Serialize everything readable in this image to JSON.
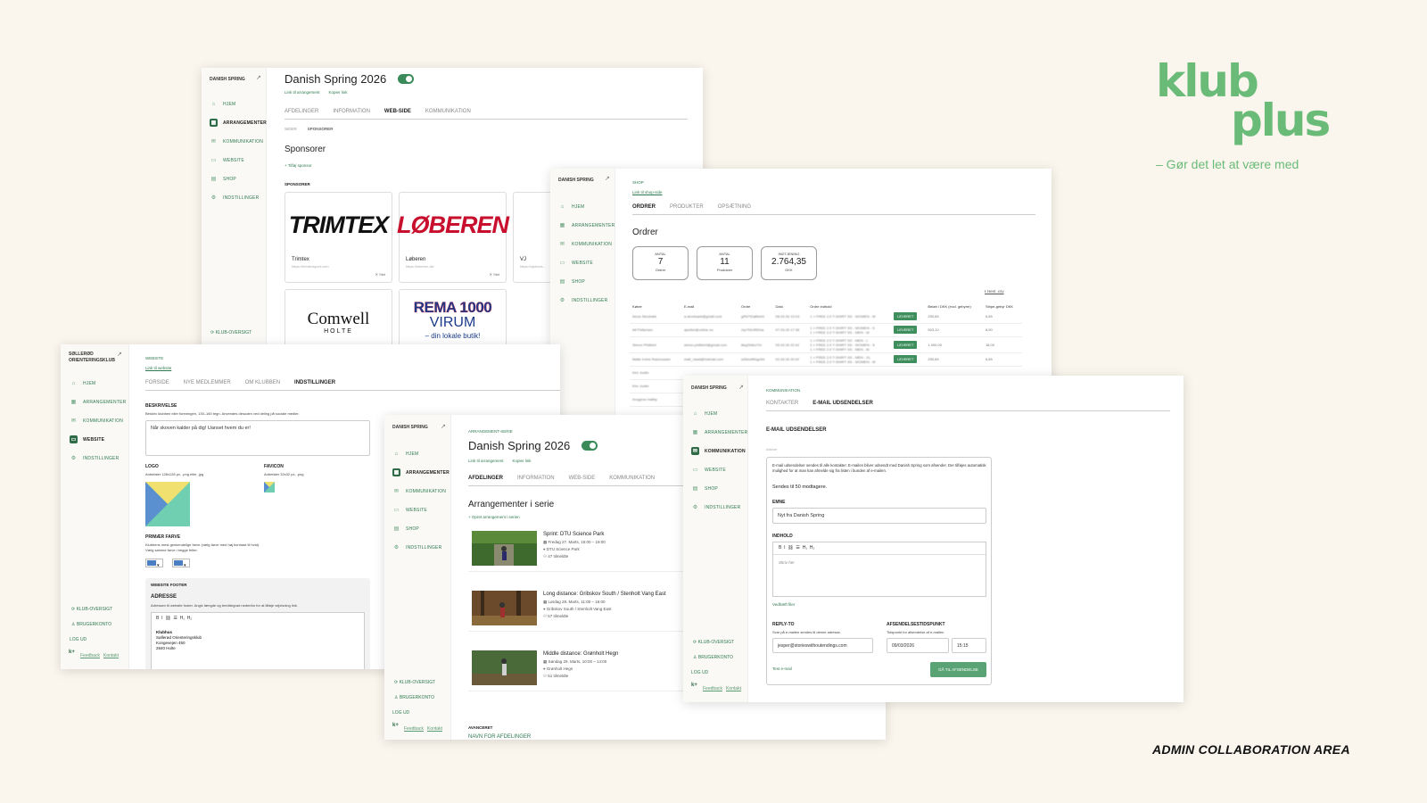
{
  "brand": {
    "line1": "klub",
    "line2": "plus",
    "tagline": "– Gør det let at være med",
    "footer": "ADMIN COLLABORATION AREA",
    "color": "#6abb78"
  },
  "nav_common": {
    "home": "HJEM",
    "events": "ARRANGEMENTER",
    "comm": "KOMMUNIKATION",
    "website": "WEBSITE",
    "shop": "SHOP",
    "settings": "INDSTILLINGER",
    "overview": "KLUB-OVERSIGT",
    "user": "BRUGERKONTO",
    "logout": "LOG UD",
    "feedback": "Feedback",
    "contact": "Kontakt",
    "kp": "k+"
  },
  "w1": {
    "org": "DANISH SPRING",
    "title": "Danish Spring 2026",
    "link1": "Link til arrangement",
    "link2": "Kopier link",
    "tabs": [
      "AFDELINGER",
      "INFORMATION",
      "WEB-SIDE",
      "KOMMUNIKATION"
    ],
    "subtabs": [
      "SIDER",
      "SPONSORER"
    ],
    "heading": "Sponsorer",
    "add": "+ Tilføj sponsor",
    "section": "SPONSORER",
    "sponsors": [
      {
        "logo": "TRIMTEX",
        "name": "Trimtex",
        "url": "https://trimtexsport.com",
        "del": "Slet"
      },
      {
        "logo": "LØBEREN",
        "name": "Løberen",
        "url": "https://loberen.dk/",
        "del": "Slet"
      },
      {
        "logo": "",
        "name": "VJ",
        "url": "https://vjshoes...",
        "del": ""
      }
    ],
    "sponsors2": [
      {
        "logo": "Comwell",
        "logo2": "HOLTE"
      },
      {
        "logo": "REMA 1000",
        "logo2": "VIRUM",
        "logo3": "– din lokale butik!"
      }
    ],
    "overview": "KLUB-OVERSIGT"
  },
  "w2": {
    "org": "DANISH SPRING",
    "crumb": "SHOP",
    "link": "Link til shop-side",
    "tabs": [
      "ORDRER",
      "PRODUKTER",
      "OPSÆTNING"
    ],
    "heading": "Ordrer",
    "stats": [
      {
        "label": "ANTAL",
        "value": "7",
        "unit": "Ordrer"
      },
      {
        "label": "ANTAL",
        "value": "11",
        "unit": "Produkter"
      },
      {
        "label": "INDTJENING",
        "value": "2.764,35",
        "unit": "DKK"
      }
    ],
    "export": "Hent .csv",
    "headers": [
      "Køber",
      "E-mail",
      "Ordre",
      "Dato",
      "Ordre indhold",
      "",
      "Beløb i DKK (excl. gebyrer)",
      "Stripe-gebyr DKK"
    ],
    "rows": [
      [
        "Anna Skovbæk",
        "a.skovbaek@gmail.com",
        "gR67f2a8fw43",
        "08.03.26 13:03",
        "1 × FREE 2.0 T-SHIRT SS - WOMEN - M",
        "LEVERET",
        "250,65",
        "5,85"
      ],
      [
        "Alf Pettersen",
        "apetter@online.no",
        "mp7f2c9f52na",
        "07.03.26 17:38",
        "1 × FREE 2.0 T-SHIRT SS - WOMEN - S\n1 × FREE 2.0 T-SHIRT SS - MEN - M",
        "LEVERET",
        "503,10",
        "8,90"
      ],
      [
        "Simon Philibert",
        "simon.philibert@gmail.com",
        "8kq2b9ev7m",
        "05.03.26 22:42",
        "1 × FREE 2.0 T-SHIRT SS - MEN - L\n2 × FREE 2.0 T-SHIRT SS - WOMEN - S\n1 × FREE 2.0 T-SHIRT SS - MEN - M",
        "LEVERET",
        "1.000,00",
        "18,00"
      ],
      [
        "Malte Irvine Rasmussen",
        "malt_rasal@hotmail.com",
        "a35es9f0qp0m",
        "02.03.26 20:02",
        "1 × FREE 2.0 T-SHIRT SS - MEN - XL\n1 × FREE 2.0 T-SHIRT SS - WOMEN - M",
        "LEVERET",
        "250,65",
        "5,85"
      ],
      [
        "Kim Justin",
        "",
        "",
        "",
        "",
        "",
        "",
        ""
      ],
      [
        "Kim Justin",
        "",
        "",
        "",
        "",
        "",
        "",
        ""
      ],
      [
        "Imogene Hallby",
        "",
        "",
        "",
        "",
        "",
        "",
        ""
      ]
    ]
  },
  "w3": {
    "org": "SØLLERØD ORIENTERINGSKLUB",
    "crumb": "WEBSITE",
    "link": "Link til website",
    "tabs": [
      "FORSIDE",
      "NYE MEDLEMMER",
      "OM KLUBBEN",
      "INDSTILLINGER"
    ],
    "desc_label": "BESKRIVELSE",
    "desc_help": "Beskriv klubben eller foreningen, 130–160 tegn. Anvendes desuden ved deling på sociale medier.",
    "desc_value": "Når skoven kalder på dig! Uanset hvem du er!",
    "logo_label": "LOGO",
    "logo_help": "Anbefaler 128x128 px, .png eller .jpg",
    "fav_label": "FAVICON",
    "fav_help": "Anbefaler 32x32 px, .png",
    "color_label": "PRIMÆR FARVE",
    "color_help": "Klubbens mest genkendelige farve (vælg farve med høj kontrast til hvid).\nVælg samme farve i begge felter.",
    "footer_label": "WEBSITE FOOTER",
    "addr_label": "ADRESSE",
    "addr_help": "Adressen til website footer. Angiv længde og breddegrad nedenfor for at tilføje vejvisning link.",
    "addr_lines": [
      "Klubhus",
      "Søllerød Orienteringsklub",
      "Kongevejen 450",
      "2840 Holte"
    ],
    "toolbar": "B  I  ⛓  ☰  H₁  H₂"
  },
  "w4": {
    "org": "DANISH SPRING",
    "crumb": "ARRANGEMENT-SERIE",
    "title": "Danish Spring 2026",
    "link1": "Link til arrangement",
    "link2": "Kopier link",
    "tabs": [
      "AFDELINGER",
      "INFORMATION",
      "WEB-SIDE",
      "KOMMUNIKATION"
    ],
    "heading": "Arrangementer i serie",
    "add": "+ Opret arrangement i serien",
    "events": [
      {
        "title": "Sprint: DTU Science Park",
        "date": "Fredag 27. Marts, 15:00 – 19:00",
        "place": "DTU Science Park",
        "count": "47 tilmeldte"
      },
      {
        "title": "Long distance: Gribskov South / Stenholt Vang East",
        "date": "Lørdag 28. Marts, 11:00 – 16:00",
        "place": "Gribskov South / Stenholt Vang East",
        "count": "57 tilmeldte"
      },
      {
        "title": "Middle distance: Grønholt Hegn",
        "date": "Søndag 29. Marts, 10:00 – 14:00",
        "place": "Grønholt Hegn",
        "count": "51 tilmeldte"
      }
    ],
    "advanced": "AVANCERET",
    "advanced2": "NAVN FOR AFDELINGER"
  },
  "w5": {
    "org": "DANISH SPRING",
    "crumb": "KOMMUNIKATION",
    "tabs": [
      "KONTAKTER",
      "E-MAIL UDSENDELSER"
    ],
    "heading": "E-MAIL UDSENDELSER",
    "archive": "Arkiver",
    "info": "E-mail udsendelser sendes til alle kontakter. E-mailen bliver udsendt med Danish Spring som afsender. Der tilføjes automatisk mulighed for at man kan afmelde sig fra listen i bunden af e-mailen.",
    "recipients": "Sendes til 50 modtagere.",
    "subject_label": "EMNE",
    "subject": "Nyt fra Danish Spring",
    "content_label": "INDHOLD",
    "content_ph": "Skriv her",
    "attach": "Vedhæft filer",
    "reply_label": "REPLY-TO",
    "reply_help": "Svar på e-mailen sendes til denne adresse.",
    "reply": "jesper@storieswithoutendings.com",
    "time_label": "AFSENDELSESTIDSPUNKT",
    "time_help": "Tidspunkt for afsendelse af e-mailen",
    "date": "09/03/2026",
    "time": "15:15",
    "test": "Test e-mail",
    "submit": "GÅ TIL AFSENDELSE",
    "toolbar": "B  I  ⛓  ☰  H₁  H₂"
  }
}
